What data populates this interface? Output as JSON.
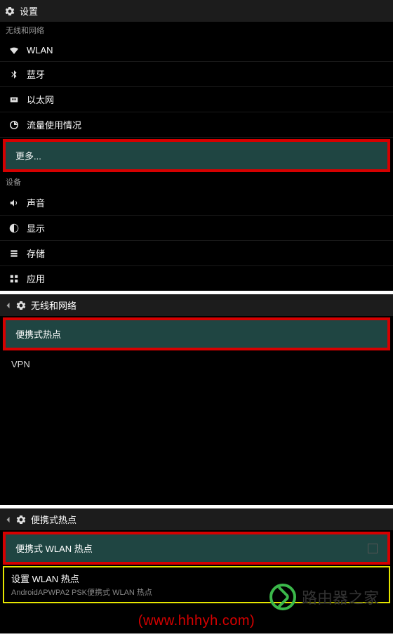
{
  "panel1": {
    "title": "设置",
    "section_wireless": "无线和网络",
    "items": {
      "wlan": "WLAN",
      "bluetooth": "蓝牙",
      "ethernet": "以太网",
      "data_usage": "流量使用情况",
      "more": "更多..."
    },
    "section_device": "设备",
    "device_items": {
      "sound": "声音",
      "display": "显示",
      "storage": "存储",
      "apps": "应用"
    }
  },
  "panel2": {
    "title": "无线和网络",
    "portable_hotspot": "便携式热点",
    "vpn": "VPN"
  },
  "panel3": {
    "title": "便携式热点",
    "portable_wlan_hotspot": "便携式 WLAN 热点",
    "setup_wlan_hotspot": "设置 WLAN 热点",
    "setup_wlan_hotspot_sub": "AndroidAPWPA2 PSK便携式 WLAN 热点",
    "brand": "路由器之家",
    "url": "(www.hhhyh.com)"
  }
}
